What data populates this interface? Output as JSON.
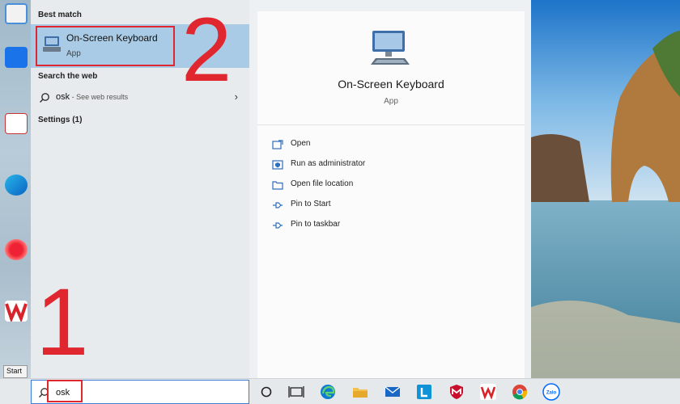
{
  "start_menu": {
    "best_match_heading": "Best match",
    "best_match": {
      "name": "On-Screen Keyboard",
      "type": "App"
    },
    "search_web_heading": "Search the web",
    "web_result": {
      "query": "osk",
      "hint": " - See web results"
    },
    "settings_heading": "Settings (1)",
    "detail": {
      "title": "On-Screen Keyboard",
      "subtitle": "App",
      "actions": [
        {
          "label": "Open",
          "icon": "open-icon"
        },
        {
          "label": "Run as administrator",
          "icon": "shield-icon"
        },
        {
          "label": "Open file location",
          "icon": "folder-icon"
        },
        {
          "label": "Pin to Start",
          "icon": "pin-icon"
        },
        {
          "label": "Pin to taskbar",
          "icon": "pin-icon"
        }
      ]
    }
  },
  "annotations": {
    "step1": "1",
    "step2": "2"
  },
  "taskbar": {
    "search_value": "osk",
    "start_tooltip": "Start",
    "apps": [
      "cortana-icon",
      "task-view-icon",
      "edge-icon",
      "file-explorer-icon",
      "mail-icon",
      "lync-icon",
      "mcafee-icon",
      "wps-icon",
      "chrome-icon",
      "zalo-icon"
    ],
    "zalo_label": "Zalo"
  },
  "colors": {
    "highlight": "#a9cbe5",
    "annotation_red": "#e0262f",
    "accent_blue": "#3a7bd5"
  }
}
